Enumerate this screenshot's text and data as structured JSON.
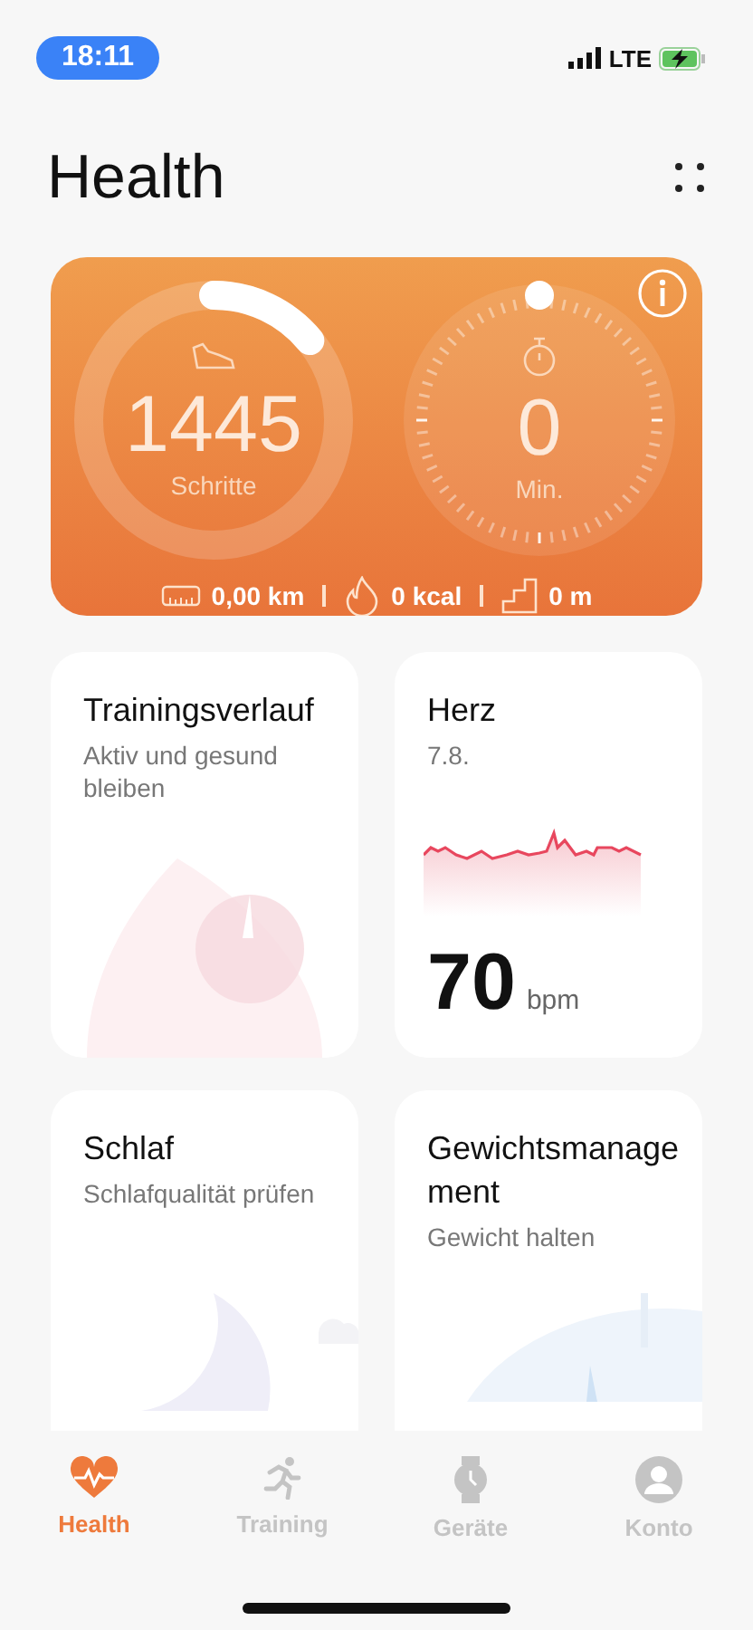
{
  "status_bar": {
    "time": "18:11",
    "network": "LTE",
    "charging": true
  },
  "header": {
    "title": "Health"
  },
  "activity": {
    "steps": {
      "value": "1445",
      "label": "Schritte",
      "level": 0.14
    },
    "minutes": {
      "value": "0",
      "label": "Min."
    },
    "stats": [
      {
        "kind": "distance",
        "text": "0,00 km"
      },
      {
        "kind": "calories",
        "text": "0 kcal"
      },
      {
        "kind": "climb",
        "text": "0 m"
      }
    ]
  },
  "cards": [
    {
      "kind": "training",
      "title": "Trainingsverlauf",
      "subtitle": "Aktiv und gesund bleiben"
    },
    {
      "kind": "heart",
      "title": "Herz",
      "subtitle": "7.8.",
      "value": "70",
      "unit": "bpm"
    },
    {
      "kind": "sleep",
      "title": "Schlaf",
      "subtitle": "Schlafqualität prüfen"
    },
    {
      "kind": "weight",
      "title": "Gewichtsmanagement",
      "subtitle": "Gewicht halten"
    }
  ],
  "tabs": [
    {
      "label": "Health",
      "selected": true,
      "kind": "heart"
    },
    {
      "label": "Training",
      "selected": false,
      "kind": "run"
    },
    {
      "label": "Geräte",
      "selected": false,
      "kind": "watch"
    },
    {
      "label": "Konto",
      "selected": false,
      "kind": "account"
    }
  ]
}
